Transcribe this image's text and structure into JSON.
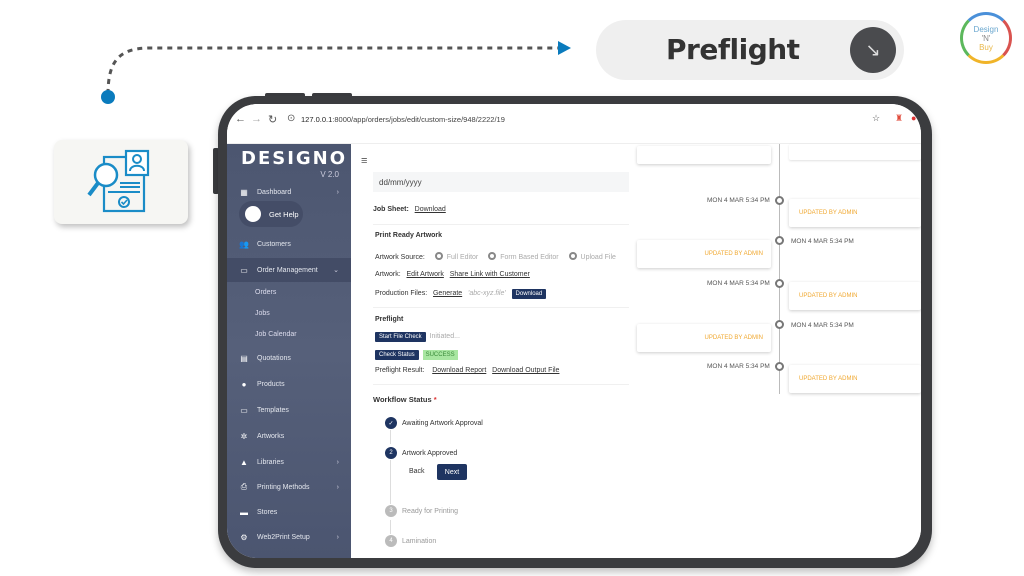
{
  "banner": {
    "title": "Preflight",
    "arrow_icon": "arrow-down-right-icon",
    "brand_lines": [
      "Design",
      "'N'",
      "Buy"
    ]
  },
  "browser": {
    "url_host": "127.0.0.1",
    "url_path": ":8000/app/orders/jobs/edit/custom-size/948/2222/19",
    "icons": [
      "back-icon",
      "forward-icon",
      "reload-icon",
      "site-info-icon",
      "star-icon",
      "extension-icon",
      "profile-icon"
    ]
  },
  "sidebar": {
    "logo": "DESIGNO",
    "version": "V 2.0",
    "get_help": "Get Help",
    "items": [
      {
        "label": "Dashboard",
        "icon": "dashboard-icon",
        "chevron": "›"
      },
      {
        "label": "Customers",
        "icon": "customers-icon"
      },
      {
        "label": "Order Management",
        "icon": "card-icon",
        "chevron": "⌄",
        "active": true
      },
      {
        "label": "Quotations",
        "icon": "quotation-icon"
      },
      {
        "label": "Products",
        "icon": "products-icon"
      },
      {
        "label": "Templates",
        "icon": "templates-icon"
      },
      {
        "label": "Artworks",
        "icon": "artworks-icon"
      },
      {
        "label": "Libraries",
        "icon": "libraries-icon",
        "chevron": "›"
      },
      {
        "label": "Printing Methods",
        "icon": "printer-icon",
        "chevron": "›"
      },
      {
        "label": "Stores",
        "icon": "store-icon"
      },
      {
        "label": "Web2Print Setup",
        "icon": "gear-icon",
        "chevron": "›"
      }
    ],
    "sub_items": [
      "Orders",
      "Jobs",
      "Job Calendar"
    ]
  },
  "main": {
    "date_placeholder": "dd/mm/yyyy",
    "job_sheet_label": "Job Sheet:",
    "job_sheet_link": "Download",
    "print_ready_title": "Print Ready Artwork",
    "artwork_source_label": "Artwork Source:",
    "artwork_source_options": [
      "Full Editor",
      "Form Based Editor",
      "Upload File"
    ],
    "artwork_label": "Artwork:",
    "edit_artwork": "Edit Artwork",
    "share_link": "Share Link with Customer",
    "production_files_label": "Production Files:",
    "generate": "Generate",
    "file_name": "'abc-xyz.file'",
    "download_btn": "Download",
    "preflight_title": "Preflight",
    "start_file_check": "Start File Check",
    "initiated": "Initiated...",
    "check_status": "Check Status",
    "status_badge": "SUCCESS",
    "preflight_result_label": "Preflight Result:",
    "download_report": "Download Report",
    "download_output": "Download Output File",
    "workflow_title": "Workflow Status",
    "required_mark": "*",
    "steps": [
      {
        "num": "✓",
        "label": "Awaiting Artwork Approval",
        "state": "done"
      },
      {
        "num": "2",
        "label": "Artwork Approved",
        "state": "active"
      },
      {
        "num": "3",
        "label": "Ready for Printing",
        "state": "pending"
      },
      {
        "num": "4",
        "label": "Lamination",
        "state": "pending"
      }
    ],
    "back": "Back",
    "next": "Next"
  },
  "timeline": {
    "entries": [
      {
        "time": "MON 4 MAR 5:34 PM",
        "text": "UPDATED BY ADMIN"
      },
      {
        "time": "MON 4 MAR 5:34 PM",
        "text": "UPDATED BY ADMIN"
      },
      {
        "time": "MON 4 MAR 5:34 PM",
        "text": "UPDATED BY ADMIN"
      },
      {
        "time": "MON 4 MAR 5:34 PM",
        "text": "UPDATED BY ADMIN"
      },
      {
        "time": "MON 4 MAR 5:34 PM",
        "text": "UPDATED BY ADMIN"
      }
    ]
  },
  "colors": {
    "accent_blue": "#0a7bbd",
    "navy": "#1e3461",
    "sidebar": "#4c5670",
    "timeline_text": "#f0a830",
    "success_bg": "#a8e6a1"
  }
}
